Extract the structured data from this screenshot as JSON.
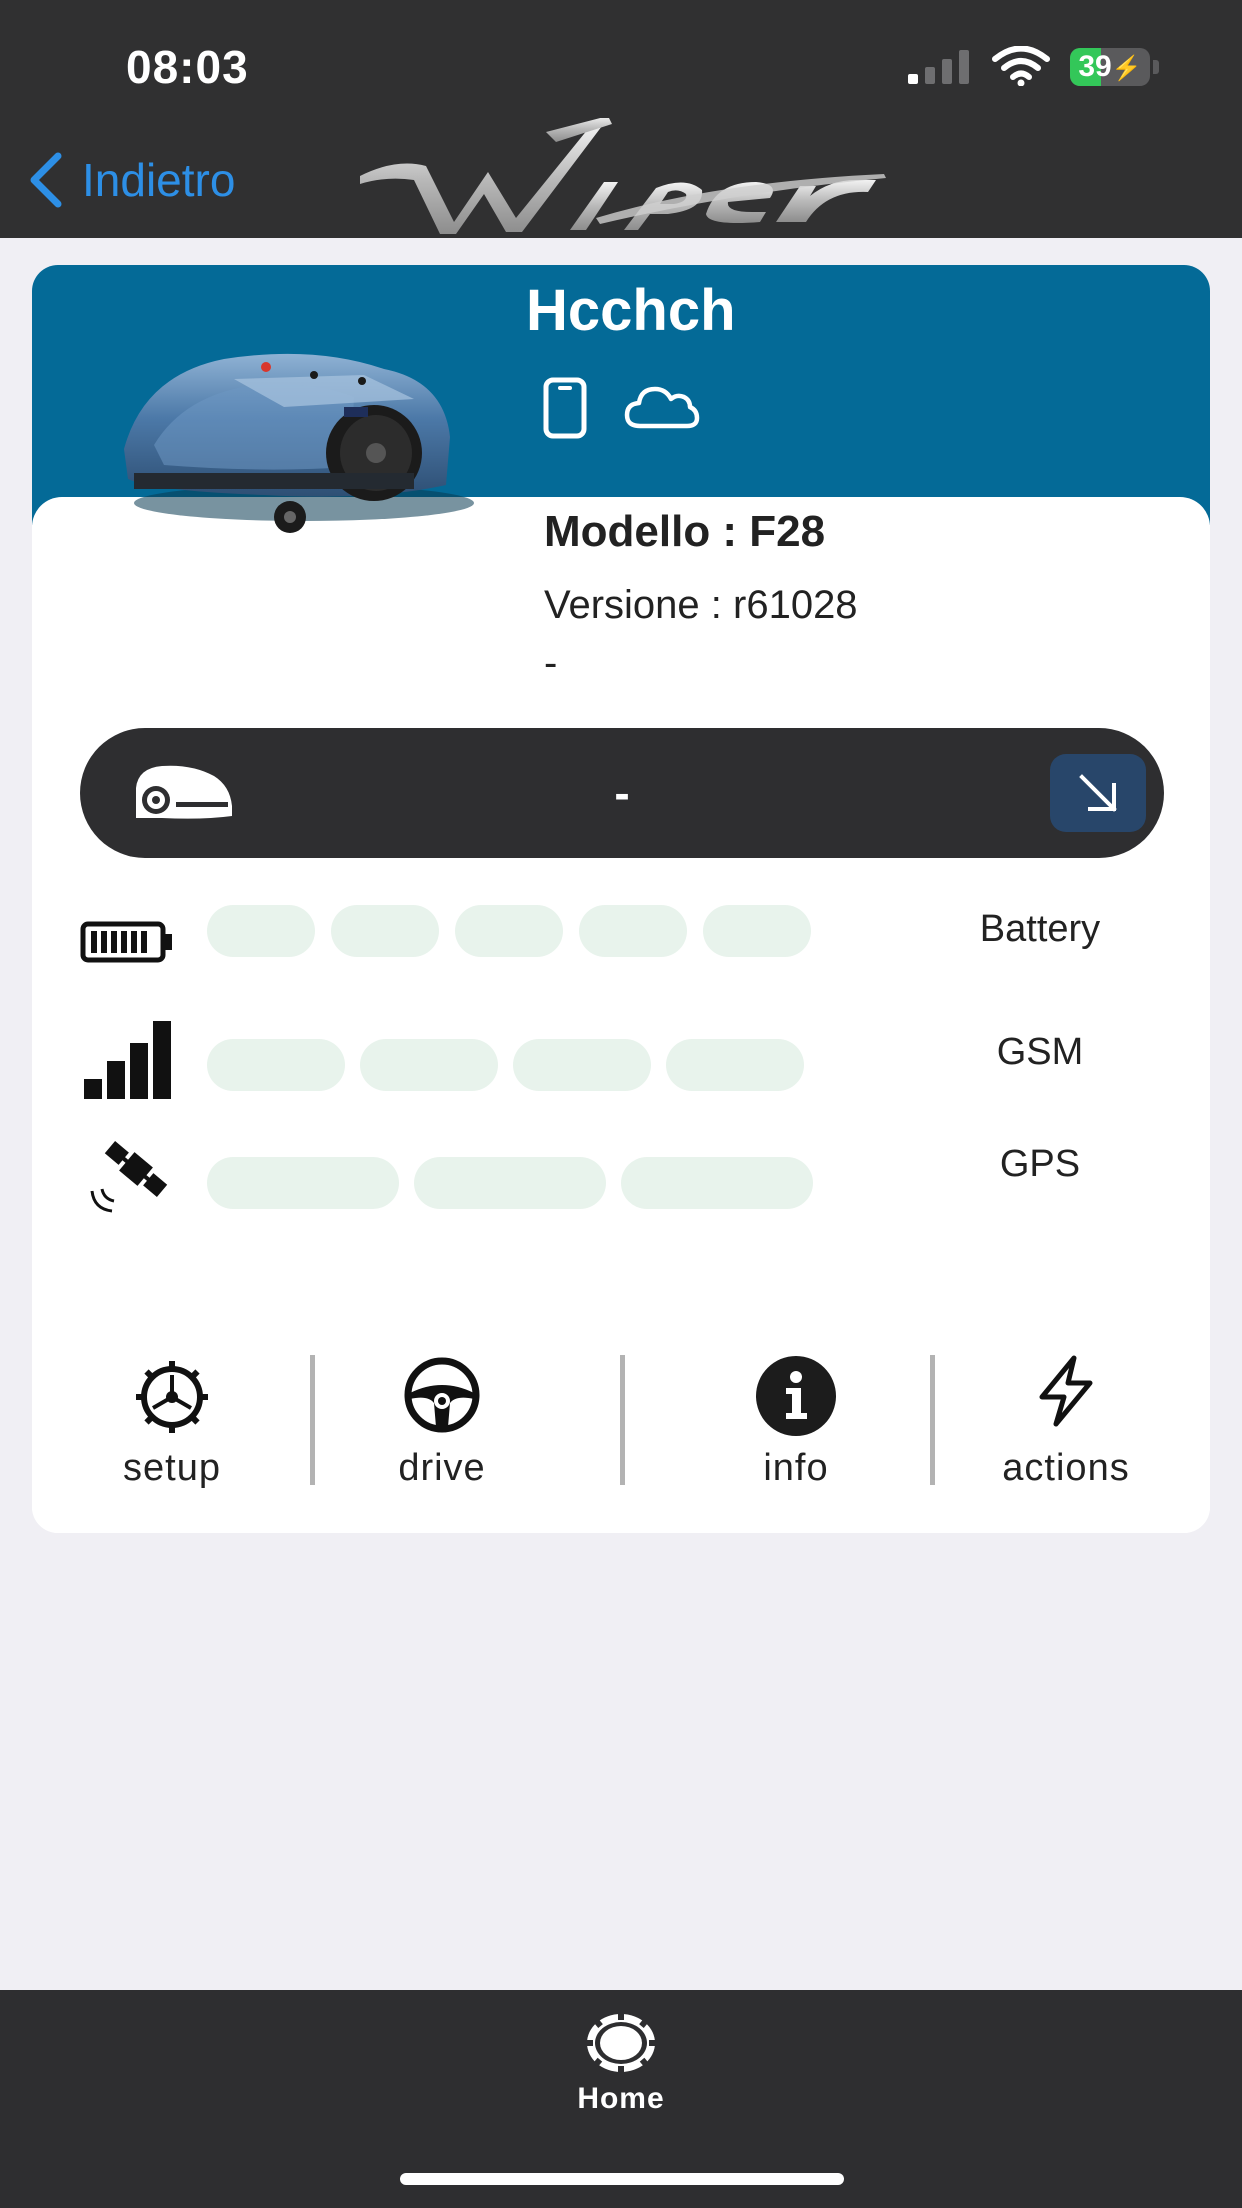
{
  "status_bar": {
    "time": "08:03",
    "battery_percent": "39",
    "battery_level": 0.39
  },
  "nav": {
    "back_label": "Indietro",
    "logo_text": "Wiper"
  },
  "device": {
    "name": "Hcchch",
    "model_line": "Modello : F28",
    "version_line": "Versione : r61028",
    "extra_line": "-",
    "state_text": "-"
  },
  "indicators": {
    "battery": {
      "label": "Battery",
      "segments_total": 5,
      "segments_filled": 0
    },
    "gsm": {
      "label": "GSM",
      "segments_total": 4,
      "segments_filled": 0
    },
    "gps": {
      "label": "GPS",
      "segments_total": 3,
      "segments_filled": 0
    }
  },
  "actions": [
    {
      "label": "setup",
      "icon": "gear-icon"
    },
    {
      "label": "drive",
      "icon": "steering-wheel-icon"
    },
    {
      "label": "info",
      "icon": "info-icon"
    },
    {
      "label": "actions",
      "icon": "lightning-icon"
    }
  ],
  "tabbar": {
    "home_label": "Home"
  },
  "colors": {
    "header_blue": "#046a97",
    "dark_bar": "#303031",
    "segment_empty": "#e8f3ec",
    "link_blue": "#2d8fe6"
  }
}
